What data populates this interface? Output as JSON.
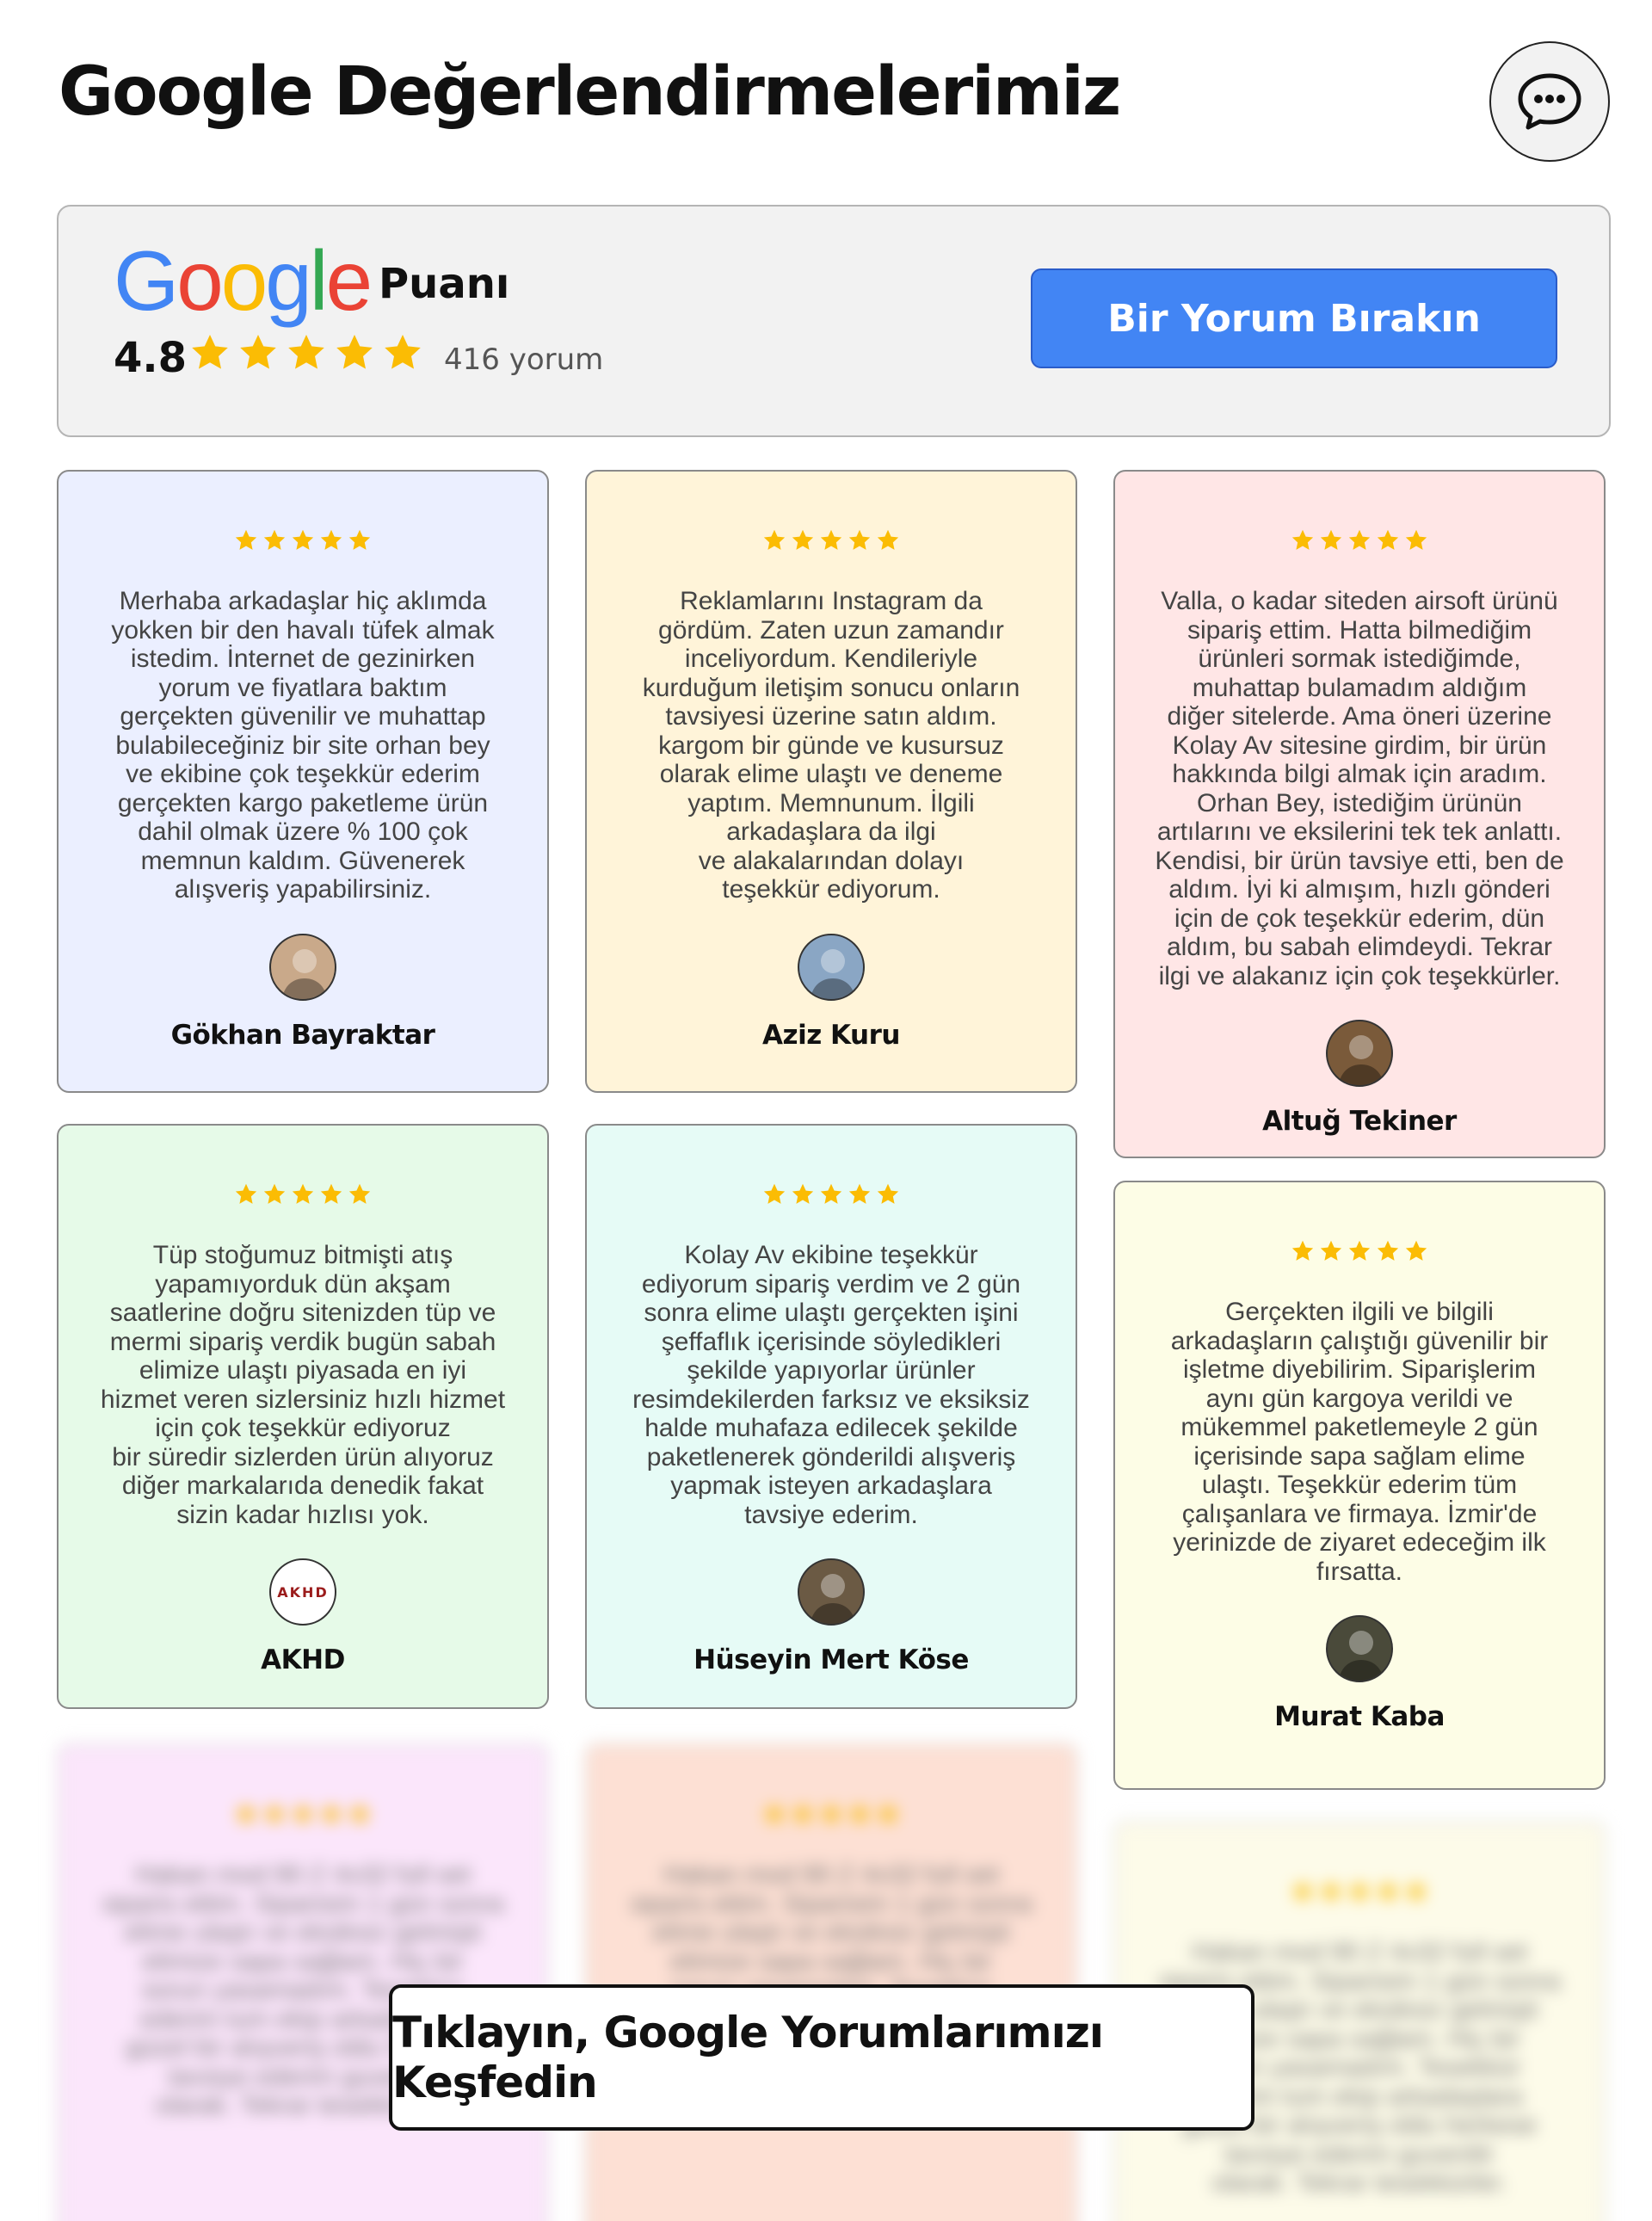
{
  "header": {
    "title": "Google Değerlendirmelerimiz",
    "chat_icon": "chat-bubble-icon"
  },
  "summary": {
    "logo_text": "Google",
    "label": "Puanı",
    "rating": "4.8",
    "stars": 5,
    "review_count": "416 yorum",
    "cta_label": "Bir Yorum Bırakın",
    "accent_color": "#4285f4",
    "star_color": "#fbbc04"
  },
  "reviews": [
    {
      "name": "Gökhan Bayraktar",
      "stars": 5,
      "bg": "#ebefff",
      "avatar_color": "#c9a98a",
      "text": "Merhaba arkadaşlar hiç aklımda\nyokken bir den havalı tüfek almak\nistedim. İnternet de gezinirken\nyorum ve fiyatlara baktım\ngerçekten güvenilir ve muhattap\nbulabileceğiniz bir site orhan bey\nve ekibine çok teşekkür ederim\ngerçekten kargo paketleme ürün\ndahil olmak üzere % 100 çok\nmemnun kaldım. Güvenerek\nalışveriş yapabilirsiniz."
    },
    {
      "name": "Aziz Kuru",
      "stars": 5,
      "bg": "#fff4d9",
      "avatar_color": "#8aa6c4",
      "text": "Reklamlarını Instagram da\ngördüm. Zaten uzun zamandır\ninceliyordum. Kendileriyle\nkurduğum iletişim sonucu onların\ntavsiyesi üzerine satın aldım.\nkargom bir günde ve kusursuz\nolarak elime ulaştı ve deneme\nyaptım.  Memnunum. İlgili\narkadaşlara da ilgi\nve alakalarından dolayı\nteşekkür ediyorum."
    },
    {
      "name": "Altuğ Tekiner",
      "stars": 5,
      "bg": "#ffe6e6",
      "avatar_color": "#7a5a3a",
      "text": "Valla, o kadar siteden airsoft ürünü\nsipariş ettim. Hatta bilmediğim\nürünleri sormak istediğimde,\nmuhattap bulamadım aldığım\ndiğer sitelerde. Ama öneri üzerine\nKolay Av sitesine girdim, bir ürün\nhakkında bilgi almak için aradım.\nOrhan Bey, istediğim ürünün\nartılarını ve eksilerini tek tek anlattı.\nKendisi, bir ürün tavsiye etti, ben de\naldım. İyi ki almışım, hızlı gönderi\niçin de çok teşekkür ederim, dün\naldım, bu sabah elimdeydi. Tekrar\nilgi ve alakanız için çok teşekkürler."
    },
    {
      "name": "AKHD",
      "stars": 5,
      "bg": "#e6fae8",
      "avatar_color": "#ffffff",
      "avatar_text": "AKHD",
      "text": "Tüp stoğumuz bitmişti atış\nyapamıyorduk dün akşam\nsaatlerine doğru sitenizden tüp ve\nmermi sipariş verdik bugün sabah\nelimize ulaştı piyasada en iyi\nhizmet veren sizlersiniz hızlı hizmet\niçin çok teşekkür ediyoruz\nbir süredir sizlerden ürün alıyoruz\ndiğer markalarıda denedik fakat\nsizin kadar hızlısı yok."
    },
    {
      "name": "Hüseyin Mert Köse",
      "stars": 5,
      "bg": "#e6fbf6",
      "avatar_color": "#6b5a44",
      "text": "Kolay Av ekibine teşekkür\nediyorum sipariş verdim ve 2 gün\nsonra elime ulaştı gerçekten işini\nşeffaflık içerisinde söyledikleri\nşekilde yapıyorlar ürünler\nresimdekilerden farksız ve eksiksiz\nhalde muhafaza edilecek şekilde\npaketlenerek gönderildi alışveriş\nyapmak isteyen arkadaşlara\ntavsiye ederim."
    },
    {
      "name": "Murat Kaba",
      "stars": 5,
      "bg": "#fdfde6",
      "avatar_color": "#4a4a3a",
      "text": "Gerçekten ilgili ve bilgili\narkadaşların çalıştığı güvenilir bir\nişletme diyebilirim. Siparişlerim\naynı gün kargoya verildi ve\nmükemmel paketlemeyle 2 gün\niçerisinde sapa sağlam elime\nulaştı. Teşekkür ederim tüm\nçalışanlara ve firmaya. İzmir'de\nyerinizde de ziyaret edeceğim ilk\nfırsatta."
    }
  ],
  "blurred_cards": [
    {
      "bg": "#fbe6fb",
      "stars": 5
    },
    {
      "bg": "#fde0d4",
      "stars": 5
    },
    {
      "bg": "#fdfbe9",
      "stars": 5
    }
  ],
  "overlay": {
    "label": "Tıklayın, Google Yorumlarımızı Keşfedin"
  }
}
